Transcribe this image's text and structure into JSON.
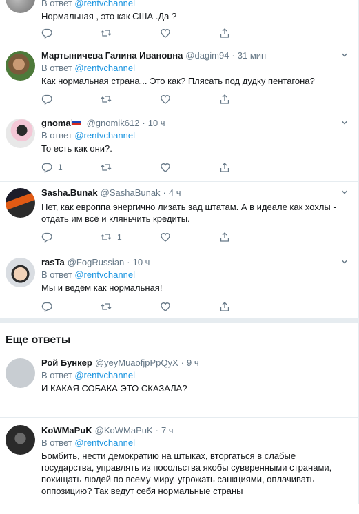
{
  "reply_prefix": "В ответ",
  "tweets": [
    {
      "author": "",
      "handle": "",
      "time": "",
      "reply_to": "@rentvchannel",
      "text": "Нормальная , это как США .Да ?",
      "replies": "",
      "retweets": "",
      "likes": ""
    },
    {
      "author": "Мартыничева Галина Ивановна",
      "handle": "@dagim94",
      "time": "31 мин",
      "reply_to": "@rentvchannel",
      "text": "Как нормальная страна... Это как? Плясать под дудку пентагона?",
      "replies": "",
      "retweets": "",
      "likes": ""
    },
    {
      "author": "gnoma",
      "handle": "@gnomik612",
      "time": "10 ч",
      "reply_to": "@rentvchannel",
      "text": "То есть как они?.",
      "replies": "1",
      "retweets": "",
      "likes": ""
    },
    {
      "author": "Sasha.Bunak",
      "handle": "@SashaBunak",
      "time": "4 ч",
      "reply_to": "",
      "text": "Нет, как европпа энергично лизать зад штатам. А в идеале как хохлы - отдать им всё и кляньчить кредиты.",
      "replies": "",
      "retweets": "1",
      "likes": ""
    },
    {
      "author": "rasTa",
      "handle": "@FogRussian",
      "time": "10 ч",
      "reply_to": "@rentvchannel",
      "text": "Мы и ведём как нормальная!",
      "replies": "",
      "retweets": "",
      "likes": ""
    }
  ],
  "more_replies_title": "Еще ответы",
  "more_tweets": [
    {
      "author": "Рой Бункер",
      "handle": "@yeyMuaofjpPpQyX",
      "time": "9 ч",
      "reply_to": "@rentvchannel",
      "text": "И КАКАЯ СОБАКА ЭТО СКАЗАЛА?"
    },
    {
      "author": "KoWMaPuK",
      "handle": "@KoWMaPuK",
      "time": "7 ч",
      "reply_to": "@rentvchannel",
      "text": "Бомбить, нести демократию на штыках, вторгаться в слабые государства, управлять из посольства якобы суверенными странами,  похищать людей по всему миру, угрожать санкциями, оплачивать оппозицию? Так ведут себя нормальные страны"
    }
  ],
  "dot": "·",
  "colors": {
    "link": "#1b95e0",
    "muted": "#657786",
    "divider": "#e6ecf0"
  }
}
